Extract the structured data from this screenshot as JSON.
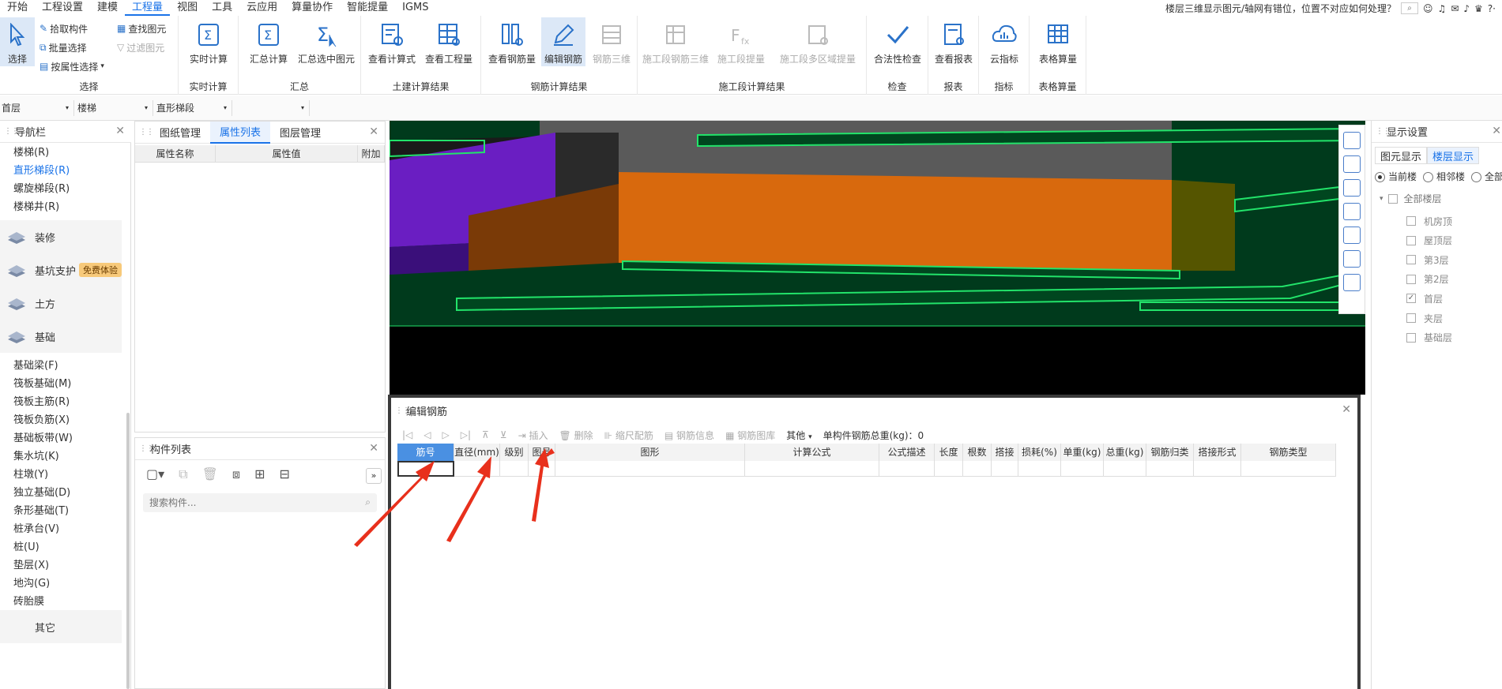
{
  "menu": {
    "items": [
      "开始",
      "工程设置",
      "建模",
      "工程量",
      "视图",
      "工具",
      "云应用",
      "算量协作",
      "智能提量",
      "IGMS"
    ],
    "active_index": 3,
    "notice": "楼层三维显示图元/轴网有错位，位置不对应如何处理？",
    "search_icon": "search-icon",
    "right_icons": [
      "smile-icon",
      "headset-icon",
      "chat-icon",
      "bell-icon",
      "shirt-icon",
      "help-icon"
    ],
    "help_label": "?·"
  },
  "ribbon": {
    "groups": [
      {
        "label": "选择",
        "big": [
          {
            "label": "选择",
            "icon": "cursor-icon",
            "selected": true
          }
        ],
        "small": [
          {
            "label": "拾取构件",
            "icon": "pick-icon",
            "disabled": false
          },
          {
            "label": "批量选择",
            "icon": "batch-select-icon",
            "disabled": false
          },
          {
            "label": "按属性选择",
            "icon": "attr-select-icon",
            "disabled": false,
            "dropdown": "▾"
          },
          {
            "label": "查找图元",
            "icon": "find-icon",
            "disabled": false
          },
          {
            "label": "过滤图元",
            "icon": "filter-icon",
            "disabled": true
          }
        ]
      },
      {
        "label": "实时计算",
        "big": [
          {
            "label": "实时计算",
            "icon": "realtime-calc-icon"
          }
        ]
      },
      {
        "label": "汇总",
        "big": [
          {
            "label": "汇总计算",
            "icon": "sigma-icon"
          },
          {
            "label": "汇总选中图元",
            "icon": "sigma-select-icon"
          }
        ]
      },
      {
        "label": "土建计算结果",
        "big": [
          {
            "label": "查看计算式",
            "icon": "formula-icon"
          },
          {
            "label": "查看工程量",
            "icon": "quantity-icon"
          }
        ]
      },
      {
        "label": "钢筋计算结果",
        "big": [
          {
            "label": "查看钢筋量",
            "icon": "rebar-qty-icon"
          },
          {
            "label": "编辑钢筋",
            "icon": "edit-rebar-icon",
            "selected": true
          },
          {
            "label": "钢筋三维",
            "icon": "rebar-3d-icon",
            "disabled": true
          }
        ]
      },
      {
        "label": "施工段计算结果",
        "big": [
          {
            "label": "施工段钢筋三维",
            "icon": "stage-3d-icon",
            "disabled": true
          },
          {
            "label": "施工段提量",
            "icon": "stage-qty-icon",
            "disabled": true
          },
          {
            "label": "施工段多区域提量",
            "icon": "stage-multi-icon",
            "disabled": true
          }
        ]
      },
      {
        "label": "检查",
        "big": [
          {
            "label": "合法性检查",
            "icon": "check-icon"
          }
        ]
      },
      {
        "label": "报表",
        "big": [
          {
            "label": "查看报表",
            "icon": "report-icon"
          }
        ]
      },
      {
        "label": "指标",
        "big": [
          {
            "label": "云指标",
            "icon": "cloud-icon"
          }
        ]
      },
      {
        "label": "表格算量",
        "big": [
          {
            "label": "表格算量",
            "icon": "table-calc-icon"
          }
        ]
      }
    ]
  },
  "selector_bar": {
    "floor": "首层",
    "category": "楼梯",
    "type": "直形梯段",
    "extra": ""
  },
  "nav": {
    "title": "导航栏",
    "items_top": [
      "楼梯(R)",
      "直形梯段(R)",
      "螺旋梯段(R)",
      "楼梯井(R)"
    ],
    "active_item": "直形梯段(R)",
    "categories": [
      {
        "label": "装修",
        "icon": "decoration-icon"
      },
      {
        "label": "基坑支护",
        "icon": "pit-support-icon",
        "badge": "免费体验"
      },
      {
        "label": "土方",
        "icon": "earthwork-icon"
      },
      {
        "label": "基础",
        "icon": "foundation-icon"
      }
    ],
    "items_bottom": [
      "基础梁(F)",
      "筏板基础(M)",
      "筏板主筋(R)",
      "筏板负筋(X)",
      "基础板带(W)",
      "集水坑(K)",
      "柱墩(Y)",
      "独立基础(D)",
      "条形基础(T)",
      "桩承台(V)",
      "桩(U)",
      "垫层(X)",
      "地沟(G)",
      "砖胎膜"
    ],
    "partial_last": "其它"
  },
  "props_panel": {
    "tabs": [
      "图纸管理",
      "属性列表",
      "图层管理"
    ],
    "active_tab": 1,
    "columns": [
      "属性名称",
      "属性值",
      "附加"
    ]
  },
  "component_list": {
    "title": "构件列表",
    "search_placeholder": "搜索构件...",
    "more": "»"
  },
  "rebar_editor": {
    "title": "编辑钢筋",
    "toolbar": [
      "插入",
      "删除",
      "缩尺配筋",
      "钢筋信息",
      "钢筋图库",
      "其他"
    ],
    "other_dropdown": "▾",
    "total_label": "单构件钢筋总重(kg)：0",
    "columns": [
      "筋号",
      "直径(mm)",
      "级别",
      "图号",
      "图形",
      "计算公式",
      "公式描述",
      "长度",
      "根数",
      "搭接",
      "损耗(%)",
      "单重(kg)",
      "总重(kg)",
      "钢筋归类",
      "搭接形式",
      "钢筋类型"
    ]
  },
  "display_settings": {
    "title": "显示设置",
    "tabs": [
      "图元显示",
      "楼层显示"
    ],
    "active_tab": 1,
    "radios": [
      "当前楼",
      "相邻楼",
      "全部"
    ],
    "radio_selected": 0,
    "root": "全部楼层",
    "floors": [
      {
        "name": "机房顶",
        "checked": false
      },
      {
        "name": "屋顶层",
        "checked": false
      },
      {
        "name": "第3层",
        "checked": false
      },
      {
        "name": "第2层",
        "checked": false
      },
      {
        "name": "首层",
        "checked": true
      },
      {
        "name": "夹层",
        "checked": false
      },
      {
        "name": "基础层",
        "checked": false
      }
    ]
  },
  "colors": {
    "accent": "#1a73e8",
    "arrow": "#e8301c",
    "slab_edge": "#22e36a",
    "beam_orange": "#d8690d",
    "column_purple": "#6a1ec2"
  }
}
